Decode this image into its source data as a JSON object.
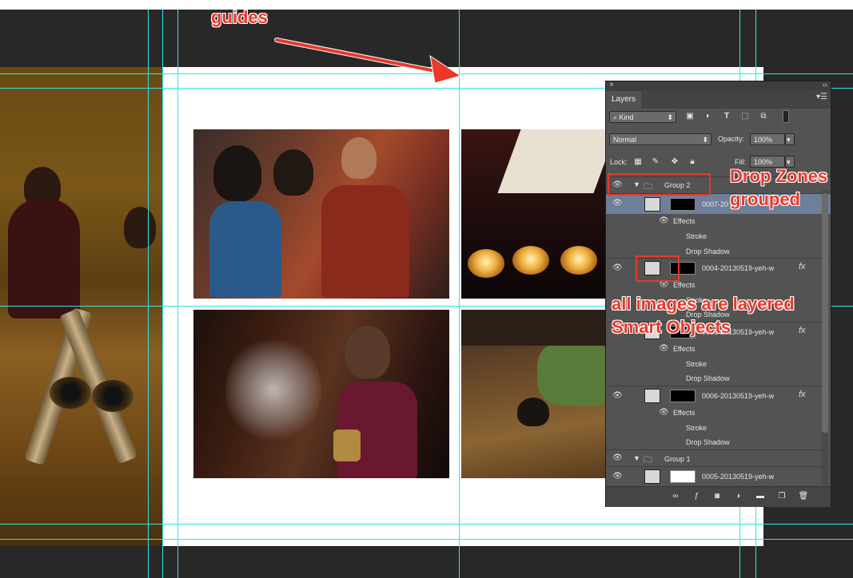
{
  "annotations": {
    "guides": "guides",
    "drop_zones_1": "Drop Zones",
    "drop_zones_2": "grouped",
    "smart_1": "all images are layered",
    "smart_2": "Smart Objects"
  },
  "layers_panel": {
    "tab": "Layers",
    "filter_kind": "Kind",
    "blend_mode": "Normal",
    "opacity_label": "Opacity:",
    "opacity_value": "100%",
    "lock_label": "Lock:",
    "fill_label": "Fill:",
    "fill_value": "100%",
    "layers": {
      "group2": "Group 2",
      "l0007": "0007-20",
      "l0007_effects": "Effects",
      "l0007_stroke": "Stroke",
      "l0007_shadow": "Drop Shadow",
      "l0004": "0004-20130519-yeh-w",
      "l0004_effects": "Effects",
      "l0004_stroke": "Stroke",
      "l0004_shadow": "Drop Shadow",
      "l0003": "0003-20130519-yeh-w",
      "l0003_effects": "Effects",
      "l0003_stroke": "Stroke",
      "l0003_shadow": "Drop Shadow",
      "l0006": "0006-20130519-yeh-w",
      "l0006_effects": "Effects",
      "l0006_stroke": "Stroke",
      "l0006_shadow": "Drop Shadow",
      "group1": "Group 1",
      "l0005": "0005-20130519-yeh-w"
    },
    "fx": "fx"
  },
  "colors": {
    "guide": "#2ee6ea",
    "annotation": "#e8392b",
    "panel_bg": "#535353"
  }
}
